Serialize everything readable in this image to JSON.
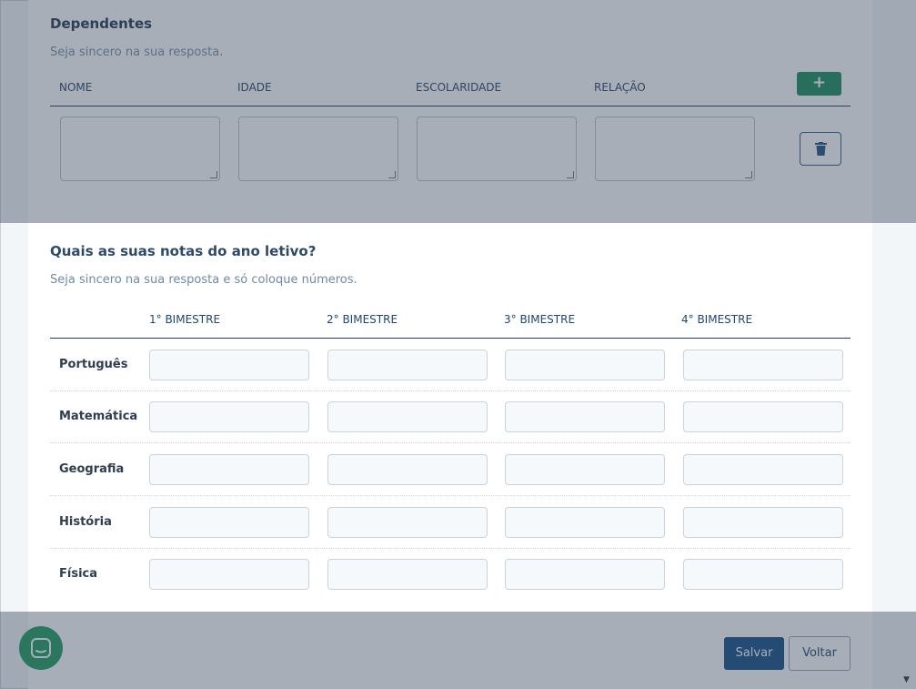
{
  "dependentes": {
    "title": "Dependentes",
    "subtitle": "Seja sincero na sua resposta.",
    "columns": [
      "NOME",
      "IDADE",
      "ESCOLARIDADE",
      "RELAÇÃO"
    ],
    "add_label": "+"
  },
  "notas": {
    "title": "Quais as suas notas do ano letivo?",
    "subtitle": "Seja sincero na sua resposta e só coloque números.",
    "columns": [
      "1° BIMESTRE",
      "2° BIMESTRE",
      "3° BIMESTRE",
      "4° BIMESTRE"
    ],
    "subjects": [
      "Português",
      "Matemática",
      "Geografia",
      "História",
      "Física"
    ]
  },
  "footer": {
    "save_label": "Salvar",
    "back_label": "Voltar"
  },
  "colors": {
    "primary": "#0f4c83",
    "success": "#168a5c",
    "chat": "#1e9a5d"
  },
  "icons": {
    "add": "plus-icon",
    "delete": "trash-icon",
    "chat": "chat-icon"
  }
}
